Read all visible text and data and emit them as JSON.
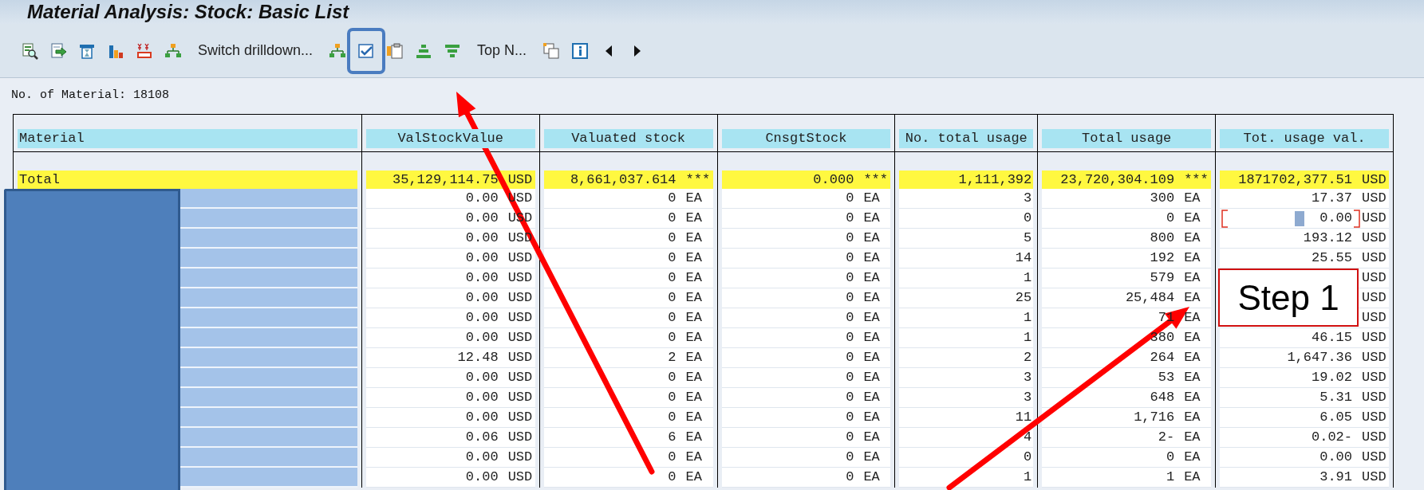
{
  "window": {
    "title": "Material Analysis: Stock: Basic List"
  },
  "toolbar": [
    {
      "kind": "icon",
      "highlighted": false
    },
    {
      "kind": "icon",
      "highlighted": false
    },
    {
      "kind": "icon",
      "highlighted": false
    },
    {
      "kind": "icon",
      "highlighted": false
    },
    {
      "kind": "icon",
      "highlighted": false
    },
    {
      "kind": "icon",
      "highlighted": false
    },
    {
      "kind": "text",
      "label": "Switch drilldown...",
      "highlighted": false
    },
    {
      "kind": "icon",
      "highlighted": false
    },
    {
      "kind": "icon",
      "highlighted": true
    },
    {
      "kind": "icon",
      "highlighted": false
    },
    {
      "kind": "icon",
      "highlighted": false
    },
    {
      "kind": "icon",
      "highlighted": false
    },
    {
      "kind": "text",
      "label": "Top N...",
      "highlighted": false
    },
    {
      "kind": "icon",
      "highlighted": false
    },
    {
      "kind": "icon",
      "highlighted": false
    },
    {
      "kind": "icon",
      "highlighted": false
    },
    {
      "kind": "icon",
      "highlighted": false
    }
  ],
  "summary": "No. of Material: 18108",
  "table": {
    "columns": [
      "Material",
      "ValStockValue",
      "Valuated stock",
      "CnsgtStock",
      "No. total usage",
      "Total usage",
      "Tot. usage val."
    ],
    "total_row": {
      "material": "Total",
      "cells": [
        {
          "value": "35,129,114.75",
          "unit": "USD"
        },
        {
          "value": "8,661,037.614",
          "unit": "***"
        },
        {
          "value": "0.000",
          "unit": "***"
        },
        {
          "value": "1,111,392"
        },
        {
          "value": "23,720,304.109",
          "unit": "***"
        },
        {
          "value": "1871702,377.51",
          "unit": "USD"
        }
      ]
    },
    "rows": [
      {
        "focused": false,
        "cells": [
          {
            "value": "0.00",
            "unit": "USD"
          },
          {
            "value": "0",
            "unit": "EA"
          },
          {
            "value": "0",
            "unit": "EA"
          },
          {
            "value": "3"
          },
          {
            "value": "300",
            "unit": "EA"
          },
          {
            "value": "17.37",
            "unit": "USD"
          }
        ]
      },
      {
        "focused": true,
        "cells": [
          {
            "value": "0.00",
            "unit": "USD"
          },
          {
            "value": "0",
            "unit": "EA"
          },
          {
            "value": "0",
            "unit": "EA"
          },
          {
            "value": "0"
          },
          {
            "value": "0",
            "unit": "EA"
          },
          {
            "value": "0.00",
            "unit": "USD"
          }
        ]
      },
      {
        "focused": false,
        "cells": [
          {
            "value": "0.00",
            "unit": "USD"
          },
          {
            "value": "0",
            "unit": "EA"
          },
          {
            "value": "0",
            "unit": "EA"
          },
          {
            "value": "5"
          },
          {
            "value": "800",
            "unit": "EA"
          },
          {
            "value": "193.12",
            "unit": "USD"
          }
        ]
      },
      {
        "focused": false,
        "cells": [
          {
            "value": "0.00",
            "unit": "USD"
          },
          {
            "value": "0",
            "unit": "EA"
          },
          {
            "value": "0",
            "unit": "EA"
          },
          {
            "value": "14"
          },
          {
            "value": "192",
            "unit": "EA"
          },
          {
            "value": "25.55",
            "unit": "USD"
          }
        ]
      },
      {
        "focused": false,
        "cells": [
          {
            "value": "0.00",
            "unit": "USD"
          },
          {
            "value": "0",
            "unit": "EA"
          },
          {
            "value": "0",
            "unit": "EA"
          },
          {
            "value": "1"
          },
          {
            "value": "579",
            "unit": "EA"
          },
          {
            "unit": "USD"
          }
        ]
      },
      {
        "focused": false,
        "cells": [
          {
            "value": "0.00",
            "unit": "USD"
          },
          {
            "value": "0",
            "unit": "EA"
          },
          {
            "value": "0",
            "unit": "EA"
          },
          {
            "value": "25"
          },
          {
            "value": "25,484",
            "unit": "EA"
          },
          {
            "unit": "USD"
          }
        ]
      },
      {
        "focused": false,
        "cells": [
          {
            "value": "0.00",
            "unit": "USD"
          },
          {
            "value": "0",
            "unit": "EA"
          },
          {
            "value": "0",
            "unit": "EA"
          },
          {
            "value": "1"
          },
          {
            "value": "71",
            "unit": "EA"
          },
          {
            "unit": "USD"
          }
        ]
      },
      {
        "focused": false,
        "cells": [
          {
            "value": "0.00",
            "unit": "USD"
          },
          {
            "value": "0",
            "unit": "EA"
          },
          {
            "value": "0",
            "unit": "EA"
          },
          {
            "value": "1"
          },
          {
            "value": "380",
            "unit": "EA"
          },
          {
            "value": "46.15",
            "unit": "USD"
          }
        ]
      },
      {
        "focused": false,
        "cells": [
          {
            "value": "12.48",
            "unit": "USD"
          },
          {
            "value": "2",
            "unit": "EA"
          },
          {
            "value": "0",
            "unit": "EA"
          },
          {
            "value": "2"
          },
          {
            "value": "264",
            "unit": "EA"
          },
          {
            "value": "1,647.36",
            "unit": "USD"
          }
        ]
      },
      {
        "focused": false,
        "cells": [
          {
            "value": "0.00",
            "unit": "USD"
          },
          {
            "value": "0",
            "unit": "EA"
          },
          {
            "value": "0",
            "unit": "EA"
          },
          {
            "value": "3"
          },
          {
            "value": "53",
            "unit": "EA"
          },
          {
            "value": "19.02",
            "unit": "USD"
          }
        ]
      },
      {
        "focused": false,
        "cells": [
          {
            "value": "0.00",
            "unit": "USD"
          },
          {
            "value": "0",
            "unit": "EA"
          },
          {
            "value": "0",
            "unit": "EA"
          },
          {
            "value": "3"
          },
          {
            "value": "648",
            "unit": "EA"
          },
          {
            "value": "5.31",
            "unit": "USD"
          }
        ]
      },
      {
        "focused": false,
        "cells": [
          {
            "value": "0.00",
            "unit": "USD"
          },
          {
            "value": "0",
            "unit": "EA"
          },
          {
            "value": "0",
            "unit": "EA"
          },
          {
            "value": "11"
          },
          {
            "value": "1,716",
            "unit": "EA"
          },
          {
            "value": "6.05",
            "unit": "USD"
          }
        ]
      },
      {
        "focused": false,
        "cells": [
          {
            "value": "0.06",
            "unit": "USD"
          },
          {
            "value": "6",
            "unit": "EA"
          },
          {
            "value": "0",
            "unit": "EA"
          },
          {
            "value": "4"
          },
          {
            "value": "2-",
            "unit": "EA"
          },
          {
            "value": "0.02-",
            "unit": "USD"
          }
        ]
      },
      {
        "focused": false,
        "cells": [
          {
            "value": "0.00",
            "unit": "USD"
          },
          {
            "value": "0",
            "unit": "EA"
          },
          {
            "value": "0",
            "unit": "EA"
          },
          {
            "value": "0"
          },
          {
            "value": "0",
            "unit": "EA"
          },
          {
            "value": "0.00",
            "unit": "USD"
          }
        ]
      },
      {
        "focused": false,
        "cells": [
          {
            "value": "0.00",
            "unit": "USD"
          },
          {
            "value": "0",
            "unit": "EA"
          },
          {
            "value": "0",
            "unit": "EA"
          },
          {
            "value": "1"
          },
          {
            "value": "1",
            "unit": "EA"
          },
          {
            "value": "3.91",
            "unit": "USD"
          }
        ]
      }
    ]
  },
  "annotation": {
    "step_label": "Step 1"
  }
}
